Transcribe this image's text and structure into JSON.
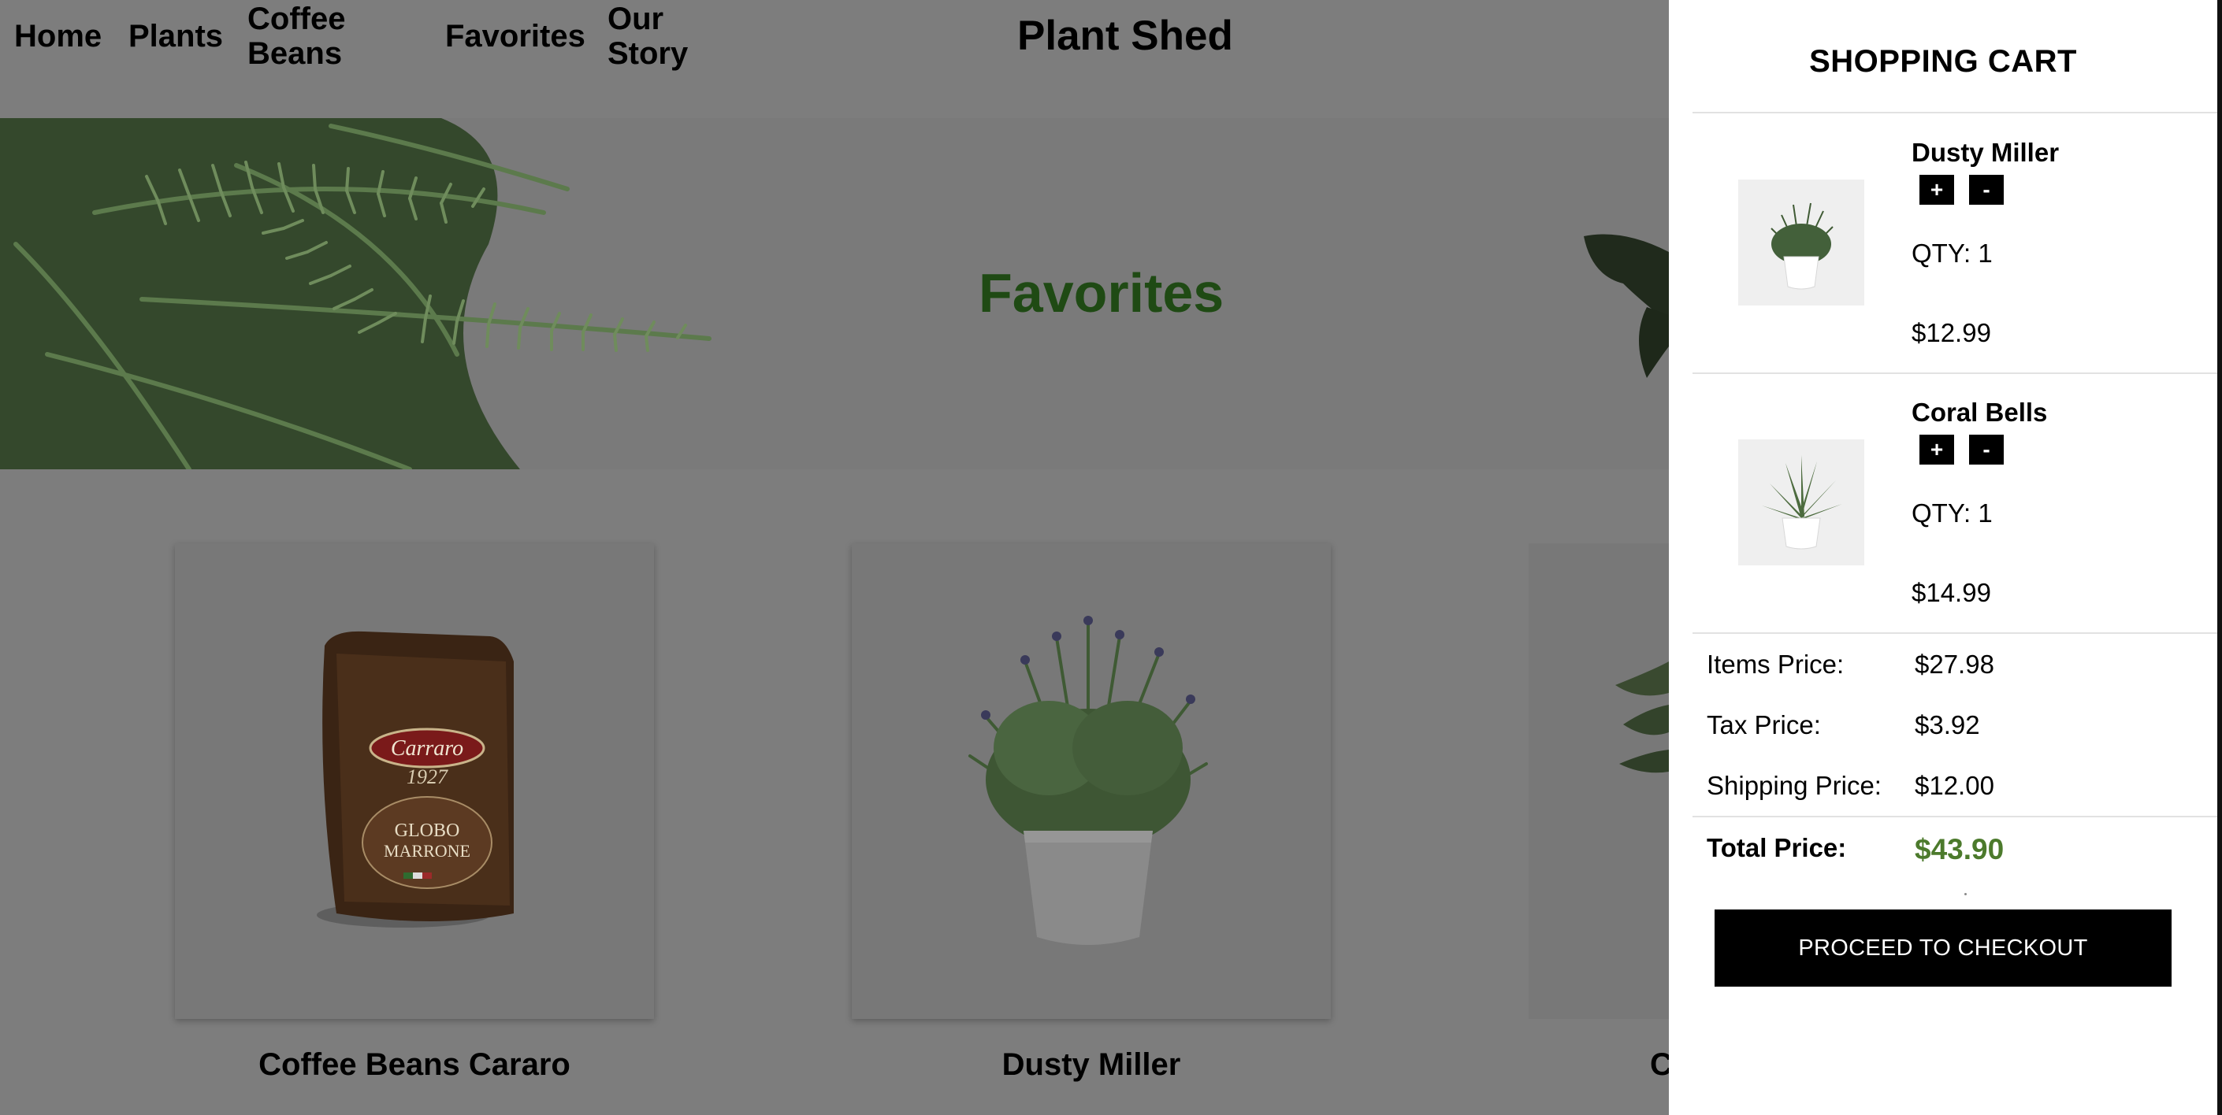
{
  "nav": {
    "home": "Home",
    "plants": "Plants",
    "coffee_line1": "Coffee",
    "coffee_line2": "Beans",
    "favorites": "Favorites",
    "story_line1": "Our",
    "story_line2": "Story"
  },
  "brand": "Plant Shed",
  "hero": {
    "title": "Favorites"
  },
  "products": [
    {
      "name": "Coffee Beans Cararo",
      "package_text_1": "Carraro",
      "package_text_2": "1927",
      "package_text_3": "GLOBO",
      "package_text_4": "MARRONE"
    },
    {
      "name": "Dusty Miller"
    },
    {
      "name": "C"
    }
  ],
  "cart": {
    "title": "SHOPPING CART",
    "items": [
      {
        "name": "Dusty Miller",
        "plus": "+",
        "minus": "-",
        "qty": "QTY: 1",
        "price": "$12.99"
      },
      {
        "name": "Coral Bells",
        "plus": "+",
        "minus": "-",
        "qty": "QTY: 1",
        "price": "$14.99"
      }
    ],
    "items_price_label": "Items Price:",
    "items_price": "$27.98",
    "tax_label": "Tax Price:",
    "tax": "$3.92",
    "shipping_label": "Shipping Price:",
    "shipping": "$12.00",
    "total_label": "Total Price:",
    "total": "$43.90",
    "checkout_label": "PROCEED TO CHECKOUT"
  },
  "colors": {
    "overlay_dim": "#7d7d7d",
    "hero_title": "#1f4a14",
    "total_price": "#4c7a2c",
    "button": "#000000"
  }
}
